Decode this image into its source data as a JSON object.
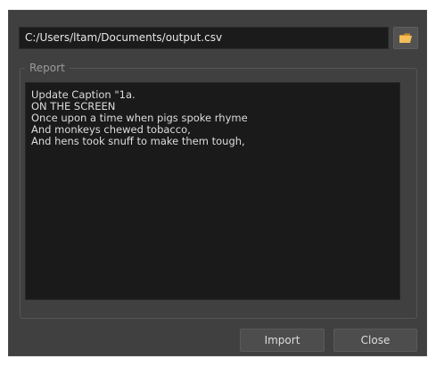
{
  "path_field": {
    "value": "C:/Users/ltam/Documents/output.csv"
  },
  "browse_button": {
    "icon": "folder-icon",
    "icon_color": "#f0c060"
  },
  "report": {
    "label": "Report",
    "text": "Update Caption \"1a.\nON THE SCREEN\nOnce upon a time when pigs spoke rhyme\nAnd monkeys chewed tobacco,\nAnd hens took snuff to make them tough,"
  },
  "buttons": {
    "import_label": "Import",
    "close_label": "Close"
  }
}
